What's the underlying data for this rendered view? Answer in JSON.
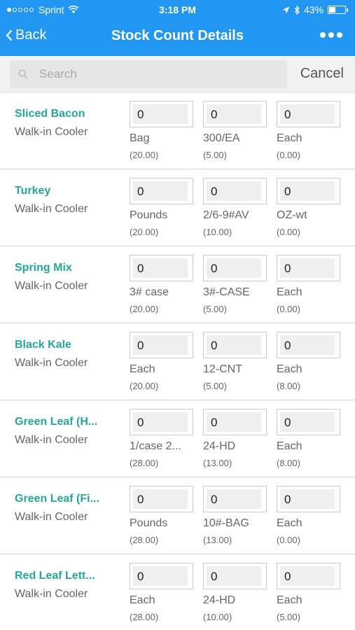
{
  "status_bar": {
    "carrier": "Sprint",
    "time": "3:18 PM",
    "battery": "43%",
    "battery_level": 0.43
  },
  "nav": {
    "back_label": "Back",
    "title": "Stock Count Details",
    "more_icon": "more-dots-icon"
  },
  "search": {
    "placeholder": "Search",
    "cancel_label": "Cancel"
  },
  "items": [
    {
      "name": "Sliced Bacon",
      "location": "Walk-in Cooler",
      "counts": [
        {
          "value": "0",
          "unit": "Bag",
          "par": "(20.00)"
        },
        {
          "value": "0",
          "unit": "300/EA",
          "par": "(5.00)"
        },
        {
          "value": "0",
          "unit": "Each",
          "par": "(0.00)"
        }
      ]
    },
    {
      "name": "Turkey",
      "location": "Walk-in Cooler",
      "counts": [
        {
          "value": "0",
          "unit": "Pounds",
          "par": "(20.00)"
        },
        {
          "value": "0",
          "unit": "2/6-9#AV",
          "par": "(10.00)"
        },
        {
          "value": "0",
          "unit": "OZ-wt",
          "par": "(0.00)"
        }
      ]
    },
    {
      "name": "Spring Mix",
      "location": "Walk-in Cooler",
      "counts": [
        {
          "value": "0",
          "unit": "3# case",
          "par": "(20.00)"
        },
        {
          "value": "0",
          "unit": "3#-CASE",
          "par": "(5.00)"
        },
        {
          "value": "0",
          "unit": "Each",
          "par": "(0.00)"
        }
      ]
    },
    {
      "name": "Black Kale",
      "location": "Walk-in Cooler",
      "counts": [
        {
          "value": "0",
          "unit": "Each",
          "par": "(20.00)"
        },
        {
          "value": "0",
          "unit": "12-CNT",
          "par": "(5.00)"
        },
        {
          "value": "0",
          "unit": "Each",
          "par": "(8.00)"
        }
      ]
    },
    {
      "name": "Green Leaf (H...",
      "location": "Walk-in Cooler",
      "counts": [
        {
          "value": "0",
          "unit": "1/case 2...",
          "par": "(28.00)"
        },
        {
          "value": "0",
          "unit": "24-HD",
          "par": "(13.00)"
        },
        {
          "value": "0",
          "unit": "Each",
          "par": "(8.00)"
        }
      ]
    },
    {
      "name": "Green Leaf (Fi...",
      "location": "Walk-in Cooler",
      "counts": [
        {
          "value": "0",
          "unit": "Pounds",
          "par": "(28.00)"
        },
        {
          "value": "0",
          "unit": "10#-BAG",
          "par": "(13.00)"
        },
        {
          "value": "0",
          "unit": "Each",
          "par": "(0.00)"
        }
      ]
    },
    {
      "name": "Red Leaf Lett...",
      "location": "Walk-in Cooler",
      "counts": [
        {
          "value": "0",
          "unit": "Each",
          "par": "(28.00)"
        },
        {
          "value": "0",
          "unit": "24-HD",
          "par": "(10.00)"
        },
        {
          "value": "0",
          "unit": "Each",
          "par": "(5.00)"
        }
      ]
    }
  ],
  "colors": {
    "header": "#2196f3",
    "item_name": "#26a69a",
    "search_bg": "#f2f2f2"
  }
}
